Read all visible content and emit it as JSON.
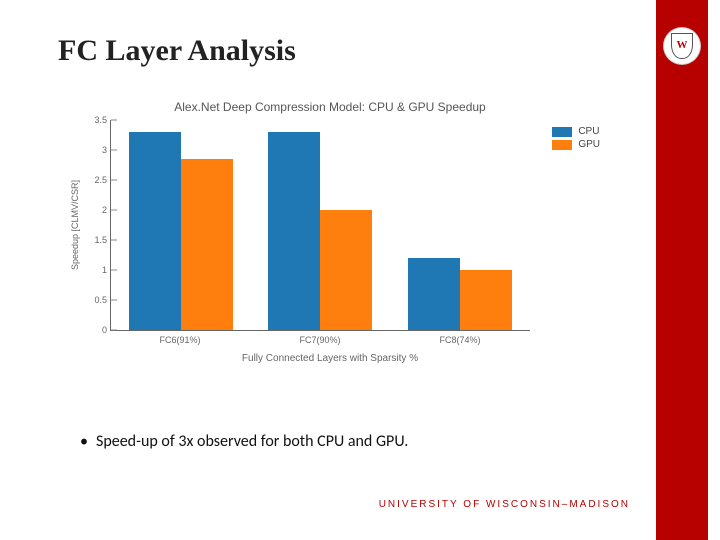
{
  "slide": {
    "title": "FC Layer Analysis",
    "bullet1": "Speed-up of 3x observed for both CPU and GPU.",
    "footer": "UNIVERSITY OF WISCONSIN–MADISON",
    "crest_letter": "W"
  },
  "chart_data": {
    "type": "bar",
    "title": "Alex.Net Deep Compression Model: CPU & GPU Speedup",
    "xlabel": "Fully Connected Layers with Sparsity %",
    "ylabel": "Speedup [CLMV/CSR]",
    "categories": [
      "FC6(91%)",
      "FC7(90%)",
      "FC8(74%)"
    ],
    "series": [
      {
        "name": "CPU",
        "color": "#1f77b4",
        "values": [
          3.3,
          3.3,
          1.2
        ]
      },
      {
        "name": "GPU",
        "color": "#ff7f0e",
        "values": [
          2.85,
          2.0,
          1.0
        ]
      }
    ],
    "ylim": [
      0,
      3.5
    ],
    "yticks": [
      0,
      0.5,
      1,
      1.5,
      2,
      2.5,
      3,
      3.5
    ]
  }
}
